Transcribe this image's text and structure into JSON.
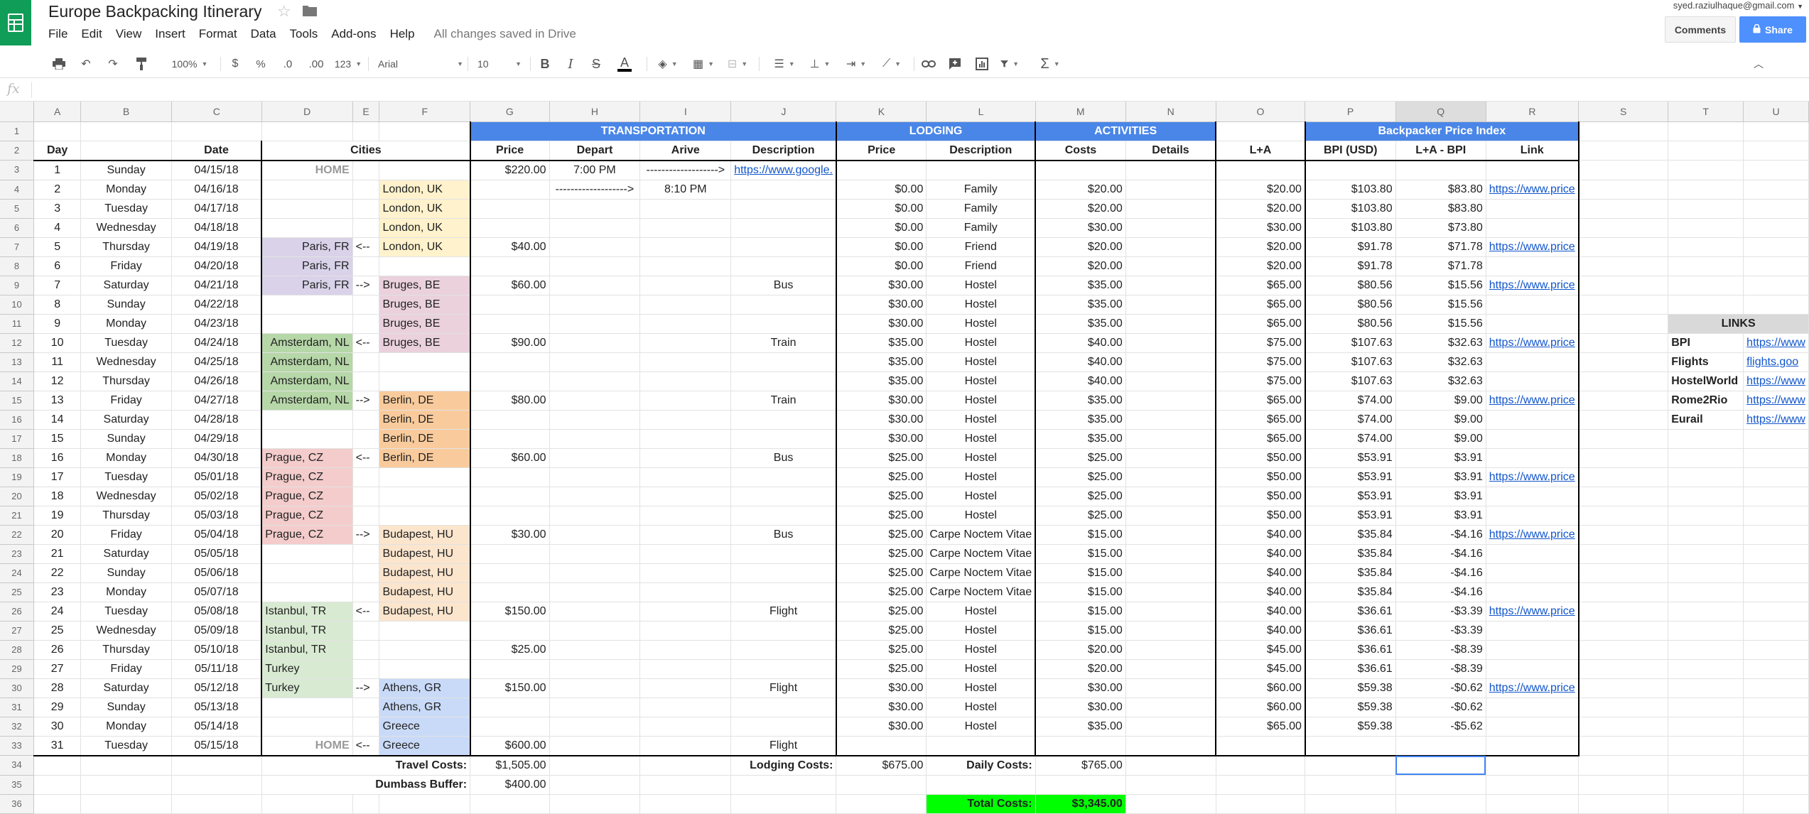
{
  "doc": {
    "title": "Europe Backpacking Itinerary",
    "saved": "All changes saved in Drive",
    "account": "syed.raziulhaque@gmail.com"
  },
  "menu": [
    "File",
    "Edit",
    "View",
    "Insert",
    "Format",
    "Data",
    "Tools",
    "Add-ons",
    "Help"
  ],
  "buttons": {
    "comments": "Comments",
    "share": "Share"
  },
  "toolbar": {
    "zoom": "100%",
    "currency": "$",
    "percent": "%",
    "dec_less": ".0",
    "dec_more": ".00",
    "more_formats": "123",
    "font": "Arial",
    "size": "10",
    "bold": "B",
    "italic": "I",
    "strike": "S",
    "text_color": "A"
  },
  "formula": {
    "fx": "fx",
    "value": ""
  },
  "columns": [
    "A",
    "B",
    "C",
    "D",
    "E",
    "F",
    "G",
    "H",
    "I",
    "J",
    "K",
    "L",
    "M",
    "N",
    "O",
    "P",
    "Q",
    "R",
    "S",
    "T",
    "U"
  ],
  "headers": {
    "transportation": "TRANSPORTATION",
    "lodging": "LODGING",
    "activities": "ACTIVITIES",
    "bpi_title": "Backpacker Price Index",
    "day": "Day",
    "date": "Date",
    "cities": "Cities",
    "price": "Price",
    "depart": "Depart",
    "arive": "Arive",
    "description": "Description",
    "lprice": "Price",
    "ldesc": "Description",
    "costs": "Costs",
    "details": "Details",
    "la": "L+A",
    "bpi": "BPI (USD)",
    "la_bpi": "L+A - BPI",
    "link": "Link"
  },
  "rows": [
    {
      "day": "1",
      "dow": "Sunday",
      "date": "04/15/18",
      "d": "HOME",
      "e": "",
      "f": "",
      "g": "$220.00",
      "h": "7:00 PM",
      "i": "------------------->",
      "j": "https://www.google.",
      "k": "",
      "l": "",
      "m": "",
      "o": "",
      "p": "",
      "q": "",
      "r": ""
    },
    {
      "day": "2",
      "dow": "Monday",
      "date": "04/16/18",
      "d": "",
      "e": "",
      "f": "London, UK",
      "g": "",
      "h": "------------------->",
      "i": "8:10 PM",
      "j": "",
      "k": "$0.00",
      "l": "Family",
      "m": "$20.00",
      "o": "$20.00",
      "p": "$103.80",
      "q": "$83.80",
      "r": "https://www.price"
    },
    {
      "day": "3",
      "dow": "Tuesday",
      "date": "04/17/18",
      "d": "",
      "e": "",
      "f": "London, UK",
      "g": "",
      "h": "",
      "i": "",
      "j": "",
      "k": "$0.00",
      "l": "Family",
      "m": "$20.00",
      "o": "$20.00",
      "p": "$103.80",
      "q": "$83.80",
      "r": ""
    },
    {
      "day": "4",
      "dow": "Wednesday",
      "date": "04/18/18",
      "d": "",
      "e": "",
      "f": "London, UK",
      "g": "",
      "h": "",
      "i": "",
      "j": "",
      "k": "$0.00",
      "l": "Family",
      "m": "$30.00",
      "o": "$30.00",
      "p": "$103.80",
      "q": "$73.80",
      "r": ""
    },
    {
      "day": "5",
      "dow": "Thursday",
      "date": "04/19/18",
      "d": "Paris, FR",
      "e": "<--",
      "f": "London, UK",
      "g": "$40.00",
      "h": "",
      "i": "",
      "j": "",
      "k": "$0.00",
      "l": "Friend",
      "m": "$20.00",
      "o": "$20.00",
      "p": "$91.78",
      "q": "$71.78",
      "r": "https://www.price"
    },
    {
      "day": "6",
      "dow": "Friday",
      "date": "04/20/18",
      "d": "Paris, FR",
      "e": "",
      "f": "",
      "g": "",
      "h": "",
      "i": "",
      "j": "",
      "k": "$0.00",
      "l": "Friend",
      "m": "$20.00",
      "o": "$20.00",
      "p": "$91.78",
      "q": "$71.78",
      "r": ""
    },
    {
      "day": "7",
      "dow": "Saturday",
      "date": "04/21/18",
      "d": "Paris, FR",
      "e": "-->",
      "f": "Bruges, BE",
      "g": "$60.00",
      "h": "",
      "i": "",
      "j": "Bus",
      "k": "$30.00",
      "l": "Hostel",
      "m": "$35.00",
      "o": "$65.00",
      "p": "$80.56",
      "q": "$15.56",
      "r": "https://www.price"
    },
    {
      "day": "8",
      "dow": "Sunday",
      "date": "04/22/18",
      "d": "",
      "e": "",
      "f": "Bruges, BE",
      "g": "",
      "h": "",
      "i": "",
      "j": "",
      "k": "$30.00",
      "l": "Hostel",
      "m": "$35.00",
      "o": "$65.00",
      "p": "$80.56",
      "q": "$15.56",
      "r": ""
    },
    {
      "day": "9",
      "dow": "Monday",
      "date": "04/23/18",
      "d": "",
      "e": "",
      "f": "Bruges, BE",
      "g": "",
      "h": "",
      "i": "",
      "j": "",
      "k": "$30.00",
      "l": "Hostel",
      "m": "$35.00",
      "o": "$65.00",
      "p": "$80.56",
      "q": "$15.56",
      "r": ""
    },
    {
      "day": "10",
      "dow": "Tuesday",
      "date": "04/24/18",
      "d": "Amsterdam, NL",
      "e": "<--",
      "f": "Bruges, BE",
      "g": "$90.00",
      "h": "",
      "i": "",
      "j": "Train",
      "k": "$35.00",
      "l": "Hostel",
      "m": "$40.00",
      "o": "$75.00",
      "p": "$107.63",
      "q": "$32.63",
      "r": "https://www.price"
    },
    {
      "day": "11",
      "dow": "Wednesday",
      "date": "04/25/18",
      "d": "Amsterdam, NL",
      "e": "",
      "f": "",
      "g": "",
      "h": "",
      "i": "",
      "j": "",
      "k": "$35.00",
      "l": "Hostel",
      "m": "$40.00",
      "o": "$75.00",
      "p": "$107.63",
      "q": "$32.63",
      "r": ""
    },
    {
      "day": "12",
      "dow": "Thursday",
      "date": "04/26/18",
      "d": "Amsterdam, NL",
      "e": "",
      "f": "",
      "g": "",
      "h": "",
      "i": "",
      "j": "",
      "k": "$35.00",
      "l": "Hostel",
      "m": "$40.00",
      "o": "$75.00",
      "p": "$107.63",
      "q": "$32.63",
      "r": ""
    },
    {
      "day": "13",
      "dow": "Friday",
      "date": "04/27/18",
      "d": "Amsterdam, NL",
      "e": "-->",
      "f": "Berlin, DE",
      "g": "$80.00",
      "h": "",
      "i": "",
      "j": "Train",
      "k": "$30.00",
      "l": "Hostel",
      "m": "$35.00",
      "o": "$65.00",
      "p": "$74.00",
      "q": "$9.00",
      "r": "https://www.price"
    },
    {
      "day": "14",
      "dow": "Saturday",
      "date": "04/28/18",
      "d": "",
      "e": "",
      "f": "Berlin, DE",
      "g": "",
      "h": "",
      "i": "",
      "j": "",
      "k": "$30.00",
      "l": "Hostel",
      "m": "$35.00",
      "o": "$65.00",
      "p": "$74.00",
      "q": "$9.00",
      "r": ""
    },
    {
      "day": "15",
      "dow": "Sunday",
      "date": "04/29/18",
      "d": "",
      "e": "",
      "f": "Berlin, DE",
      "g": "",
      "h": "",
      "i": "",
      "j": "",
      "k": "$30.00",
      "l": "Hostel",
      "m": "$35.00",
      "o": "$65.00",
      "p": "$74.00",
      "q": "$9.00",
      "r": ""
    },
    {
      "day": "16",
      "dow": "Monday",
      "date": "04/30/18",
      "d": "Prague, CZ",
      "e": "<--",
      "f": "Berlin, DE",
      "g": "$60.00",
      "h": "",
      "i": "",
      "j": "Bus",
      "k": "$25.00",
      "l": "Hostel",
      "m": "$25.00",
      "o": "$50.00",
      "p": "$53.91",
      "q": "$3.91",
      "r": ""
    },
    {
      "day": "17",
      "dow": "Tuesday",
      "date": "05/01/18",
      "d": "Prague, CZ",
      "e": "",
      "f": "",
      "g": "",
      "h": "",
      "i": "",
      "j": "",
      "k": "$25.00",
      "l": "Hostel",
      "m": "$25.00",
      "o": "$50.00",
      "p": "$53.91",
      "q": "$3.91",
      "r": "https://www.price"
    },
    {
      "day": "18",
      "dow": "Wednesday",
      "date": "05/02/18",
      "d": "Prague, CZ",
      "e": "",
      "f": "",
      "g": "",
      "h": "",
      "i": "",
      "j": "",
      "k": "$25.00",
      "l": "Hostel",
      "m": "$25.00",
      "o": "$50.00",
      "p": "$53.91",
      "q": "$3.91",
      "r": ""
    },
    {
      "day": "19",
      "dow": "Thursday",
      "date": "05/03/18",
      "d": "Prague, CZ",
      "e": "",
      "f": "",
      "g": "",
      "h": "",
      "i": "",
      "j": "",
      "k": "$25.00",
      "l": "Hostel",
      "m": "$25.00",
      "o": "$50.00",
      "p": "$53.91",
      "q": "$3.91",
      "r": ""
    },
    {
      "day": "20",
      "dow": "Friday",
      "date": "05/04/18",
      "d": "Prague, CZ",
      "e": "-->",
      "f": "Budapest, HU",
      "g": "$30.00",
      "h": "",
      "i": "",
      "j": "Bus",
      "k": "$25.00",
      "l": "Carpe Noctem Vitae",
      "m": "$15.00",
      "o": "$40.00",
      "p": "$35.84",
      "q": "-$4.16",
      "r": "https://www.price"
    },
    {
      "day": "21",
      "dow": "Saturday",
      "date": "05/05/18",
      "d": "",
      "e": "",
      "f": "Budapest, HU",
      "g": "",
      "h": "",
      "i": "",
      "j": "",
      "k": "$25.00",
      "l": "Carpe Noctem Vitae",
      "m": "$15.00",
      "o": "$40.00",
      "p": "$35.84",
      "q": "-$4.16",
      "r": ""
    },
    {
      "day": "22",
      "dow": "Sunday",
      "date": "05/06/18",
      "d": "",
      "e": "",
      "f": "Budapest, HU",
      "g": "",
      "h": "",
      "i": "",
      "j": "",
      "k": "$25.00",
      "l": "Carpe Noctem Vitae",
      "m": "$15.00",
      "o": "$40.00",
      "p": "$35.84",
      "q": "-$4.16",
      "r": ""
    },
    {
      "day": "23",
      "dow": "Monday",
      "date": "05/07/18",
      "d": "",
      "e": "",
      "f": "Budapest, HU",
      "g": "",
      "h": "",
      "i": "",
      "j": "",
      "k": "$25.00",
      "l": "Carpe Noctem Vitae",
      "m": "$15.00",
      "o": "$40.00",
      "p": "$35.84",
      "q": "-$4.16",
      "r": ""
    },
    {
      "day": "24",
      "dow": "Tuesday",
      "date": "05/08/18",
      "d": "Istanbul, TR",
      "e": "<--",
      "f": "Budapest, HU",
      "g": "$150.00",
      "h": "",
      "i": "",
      "j": "Flight",
      "k": "$25.00",
      "l": "Hostel",
      "m": "$15.00",
      "o": "$40.00",
      "p": "$36.61",
      "q": "-$3.39",
      "r": "https://www.price"
    },
    {
      "day": "25",
      "dow": "Wednesday",
      "date": "05/09/18",
      "d": "Istanbul, TR",
      "e": "",
      "f": "",
      "g": "",
      "h": "",
      "i": "",
      "j": "",
      "k": "$25.00",
      "l": "Hostel",
      "m": "$15.00",
      "o": "$40.00",
      "p": "$36.61",
      "q": "-$3.39",
      "r": ""
    },
    {
      "day": "26",
      "dow": "Thursday",
      "date": "05/10/18",
      "d": "Istanbul, TR",
      "e": "",
      "f": "",
      "g": "$25.00",
      "h": "",
      "i": "",
      "j": "",
      "k": "$25.00",
      "l": "Hostel",
      "m": "$20.00",
      "o": "$45.00",
      "p": "$36.61",
      "q": "-$8.39",
      "r": ""
    },
    {
      "day": "27",
      "dow": "Friday",
      "date": "05/11/18",
      "d": "Turkey",
      "e": "",
      "f": "",
      "g": "",
      "h": "",
      "i": "",
      "j": "",
      "k": "$25.00",
      "l": "Hostel",
      "m": "$20.00",
      "o": "$45.00",
      "p": "$36.61",
      "q": "-$8.39",
      "r": ""
    },
    {
      "day": "28",
      "dow": "Saturday",
      "date": "05/12/18",
      "d": "Turkey",
      "e": "-->",
      "f": "Athens, GR",
      "g": "$150.00",
      "h": "",
      "i": "",
      "j": "Flight",
      "k": "$30.00",
      "l": "Hostel",
      "m": "$30.00",
      "o": "$60.00",
      "p": "$59.38",
      "q": "-$0.62",
      "r": "https://www.price"
    },
    {
      "day": "29",
      "dow": "Sunday",
      "date": "05/13/18",
      "d": "",
      "e": "",
      "f": "Athens, GR",
      "g": "",
      "h": "",
      "i": "",
      "j": "",
      "k": "$30.00",
      "l": "Hostel",
      "m": "$30.00",
      "o": "$60.00",
      "p": "$59.38",
      "q": "-$0.62",
      "r": ""
    },
    {
      "day": "30",
      "dow": "Monday",
      "date": "05/14/18",
      "d": "",
      "e": "",
      "f": "Greece",
      "g": "",
      "h": "",
      "i": "",
      "j": "",
      "k": "$30.00",
      "l": "Hostel",
      "m": "$35.00",
      "o": "$65.00",
      "p": "$59.38",
      "q": "-$5.62",
      "r": ""
    },
    {
      "day": "31",
      "dow": "Tuesday",
      "date": "05/15/18",
      "d": "HOME",
      "e": "<--",
      "f": "Greece",
      "g": "$600.00",
      "h": "",
      "i": "",
      "j": "Flight",
      "k": "",
      "l": "",
      "m": "",
      "o": "",
      "p": "",
      "q": "",
      "r": ""
    }
  ],
  "totals": {
    "travel_label": "Travel Costs:",
    "travel": "$1,505.00",
    "lodging_label": "Lodging Costs:",
    "lodging": "$675.00",
    "daily_label": "Daily Costs:",
    "daily": "$765.00",
    "buffer_label": "Dumbass Buffer:",
    "buffer": "$400.00",
    "total_label": "Total Costs:",
    "total": "$3,345.00"
  },
  "links": {
    "title": "LINKS",
    "items": [
      {
        "name": "BPI",
        "url": "https://www"
      },
      {
        "name": "Flights",
        "url": "flights.goo"
      },
      {
        "name": "HostelWorld",
        "url": "https://www"
      },
      {
        "name": "Rome2Rio",
        "url": "https://www"
      },
      {
        "name": "Eurail",
        "url": "https://www"
      }
    ]
  }
}
